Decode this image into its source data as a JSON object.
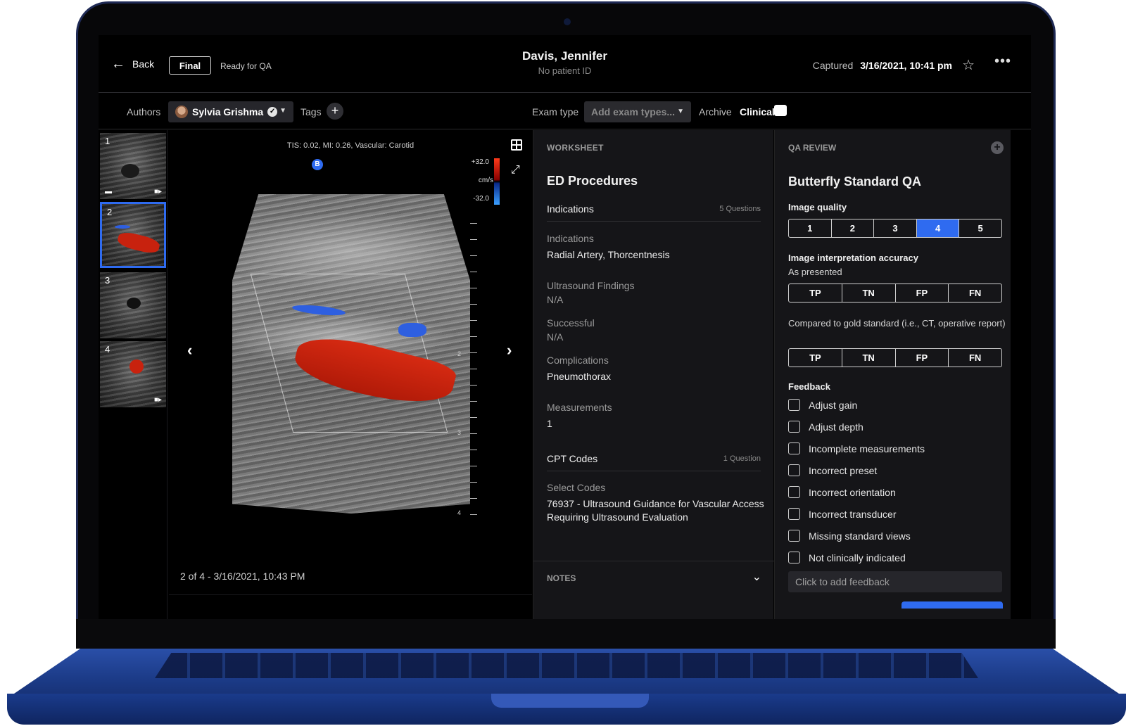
{
  "header": {
    "back_label": "Back",
    "status_button": "Final",
    "status_text": "Ready for QA",
    "patient_name": "Davis, Jennifer",
    "patient_id": "No patient ID",
    "captured_label": "Captured",
    "captured_value": "3/16/2021, 10:41 pm",
    "star_icon": "star-icon",
    "more_icon": "more-icon"
  },
  "toolbar": {
    "authors_label": "Authors",
    "author_name": "Sylvia Grishma",
    "tags_label": "Tags",
    "exam_type_label": "Exam type",
    "exam_type_placeholder": "Add exam types...",
    "archive_label": "Archive",
    "archive_value": "Clinical"
  },
  "thumbnails": [
    {
      "num": "1"
    },
    {
      "num": "2"
    },
    {
      "num": "3"
    },
    {
      "num": "4"
    }
  ],
  "viewer": {
    "meta": "TIS: 0.02, MI: 0.26, Vascular: Carotid",
    "badge": "B",
    "scale_top": "+32.0",
    "scale_unit": "cm/s",
    "scale_bottom": "-32.0",
    "depth_labels": [
      "2",
      "3",
      "4"
    ],
    "footer": "2 of 4 - 3/16/2021, 10:43 PM"
  },
  "worksheet": {
    "heading": "WORKSHEET",
    "title": "ED Procedures",
    "section1": {
      "label": "Indications",
      "count": "5 Questions"
    },
    "fields": [
      {
        "label": "Indications",
        "value": "Radial Artery, Thorcentnesis"
      },
      {
        "label": "Ultrasound Findings",
        "value": "N/A"
      },
      {
        "label": "Successful",
        "value": "N/A"
      },
      {
        "label": "Complications",
        "value": "Pneumothorax"
      },
      {
        "label": "Measurements",
        "value": "1"
      }
    ],
    "section2": {
      "label": "CPT Codes",
      "count": "1 Question"
    },
    "codes_label": "Select Codes",
    "codes_value": "76937 - Ultrasound Guidance for Vascular Access Requiring Ultrasound Evaluation",
    "notes_label": "NOTES"
  },
  "qa": {
    "heading": "QA REVIEW",
    "title": "Butterfly Standard QA",
    "image_quality_label": "Image quality",
    "image_quality_options": [
      "1",
      "2",
      "3",
      "4",
      "5"
    ],
    "image_quality_selected": "4",
    "accuracy_label": "Image interpretation accuracy",
    "as_presented": "As presented",
    "accuracy_options": [
      "TP",
      "TN",
      "FP",
      "FN"
    ],
    "gold_standard": "Compared to gold standard (i.e., CT, operative report)",
    "feedback_label": "Feedback",
    "feedback_items": [
      "Adjust gain",
      "Adjust depth",
      "Incomplete measurements",
      "Incorrect preset",
      "Incorrect orientation",
      "Incorrect transducer",
      "Missing standard views",
      "Not clinically indicated"
    ],
    "feedback_placeholder": "Click to add feedback"
  },
  "colors": {
    "accent": "#2f6bf0",
    "laptop_blue": "#1b3a86"
  }
}
